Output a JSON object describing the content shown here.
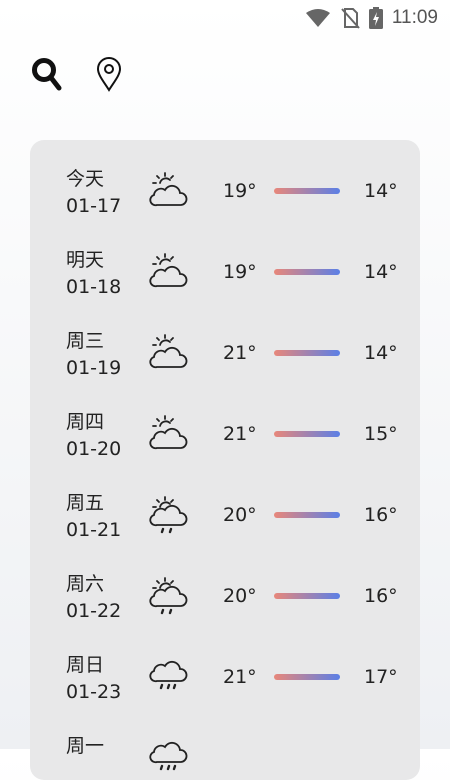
{
  "status_bar": {
    "time": "11:09",
    "icons": [
      "wifi-icon",
      "no-sim-icon",
      "battery-charging-icon"
    ]
  },
  "toolbar": {
    "icons": [
      "search-icon",
      "location-pin-icon"
    ]
  },
  "colors": {
    "bar_warm": "#e8877a",
    "bar_cool": "#5b7fe6",
    "card_bg": "#e8e8e9"
  },
  "forecast": [
    {
      "day": "今天",
      "date": "01-17",
      "icon": "partly-cloudy-icon",
      "high": "19°",
      "low": "14°"
    },
    {
      "day": "明天",
      "date": "01-18",
      "icon": "partly-cloudy-icon",
      "high": "19°",
      "low": "14°"
    },
    {
      "day": "周三",
      "date": "01-19",
      "icon": "partly-cloudy-icon",
      "high": "21°",
      "low": "14°"
    },
    {
      "day": "周四",
      "date": "01-20",
      "icon": "partly-cloudy-icon",
      "high": "21°",
      "low": "15°"
    },
    {
      "day": "周五",
      "date": "01-21",
      "icon": "sun-cloud-rain-icon",
      "high": "20°",
      "low": "16°"
    },
    {
      "day": "周六",
      "date": "01-22",
      "icon": "sun-cloud-rain-icon",
      "high": "20°",
      "low": "16°"
    },
    {
      "day": "周日",
      "date": "01-23",
      "icon": "cloud-rain-icon",
      "high": "21°",
      "low": "17°"
    },
    {
      "day": "周一",
      "date": "",
      "icon": "cloud-rain-icon",
      "high": "",
      "low": ""
    }
  ]
}
